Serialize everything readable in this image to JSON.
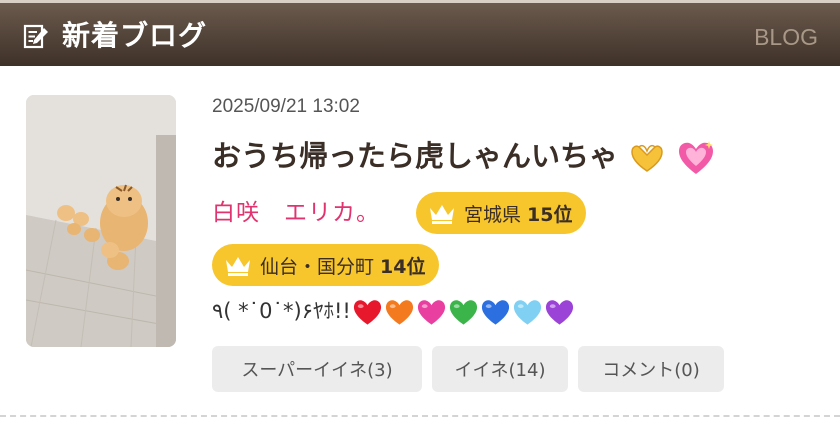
{
  "header": {
    "title": "新着ブログ",
    "link_label": "BLOG",
    "icon": "edit-note-icon"
  },
  "post": {
    "thumbnail": "tiger-plush-photo",
    "date": "2025/09/21 13:02",
    "title": "おうち帰ったら虎しゃんいちゃ",
    "title_emojis": [
      "heart-hands-icon",
      "sparkling-heart-icon"
    ],
    "author": "白咲　エリカ。",
    "ranks": [
      {
        "area": "宮城県",
        "rank": "15位"
      },
      {
        "area": "仙台・国分町",
        "rank": "14位"
      }
    ],
    "excerpt": "٩( *˙0˙*)۶ﾔﾎ!!",
    "excerpt_hearts": [
      "#e8182c",
      "#f47a1f",
      "#e83fa0",
      "#3bb54a",
      "#2c6fe0",
      "#7fd0f2",
      "#9b43d6"
    ]
  },
  "actions": {
    "super_like": "スーパーイイネ(3)",
    "like": "イイネ(14)",
    "comment": "コメント(0)"
  },
  "colors": {
    "header_bg": "#4f4137",
    "author": "#e0336f",
    "rank_badge": "#f7c52c",
    "button_bg": "#ececec"
  }
}
